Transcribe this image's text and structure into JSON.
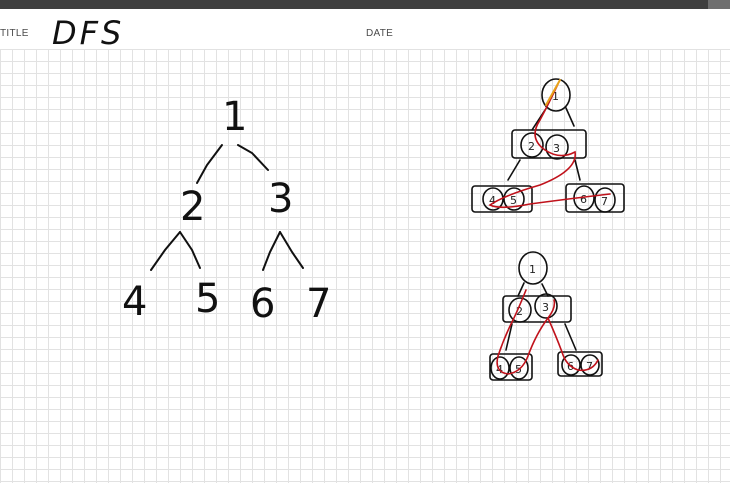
{
  "header": {
    "title_label": "TITLE",
    "title_value": "DFS",
    "date_label": "DATE"
  },
  "tree": {
    "root": "1",
    "level2": [
      "2",
      "3"
    ],
    "leaves": [
      "4",
      "5",
      "6",
      "7"
    ]
  },
  "sketch_1": {
    "nodes": [
      "1",
      "2",
      "3",
      "4",
      "5",
      "6",
      "7"
    ]
  },
  "sketch_2": {
    "nodes": [
      "1",
      "2",
      "3",
      "4",
      "5",
      "6",
      "7"
    ]
  },
  "colors": {
    "ink": "#111111",
    "red_ink": "#c0121b",
    "highlight": "#e8a21a",
    "grid": "#e2e2e2"
  }
}
